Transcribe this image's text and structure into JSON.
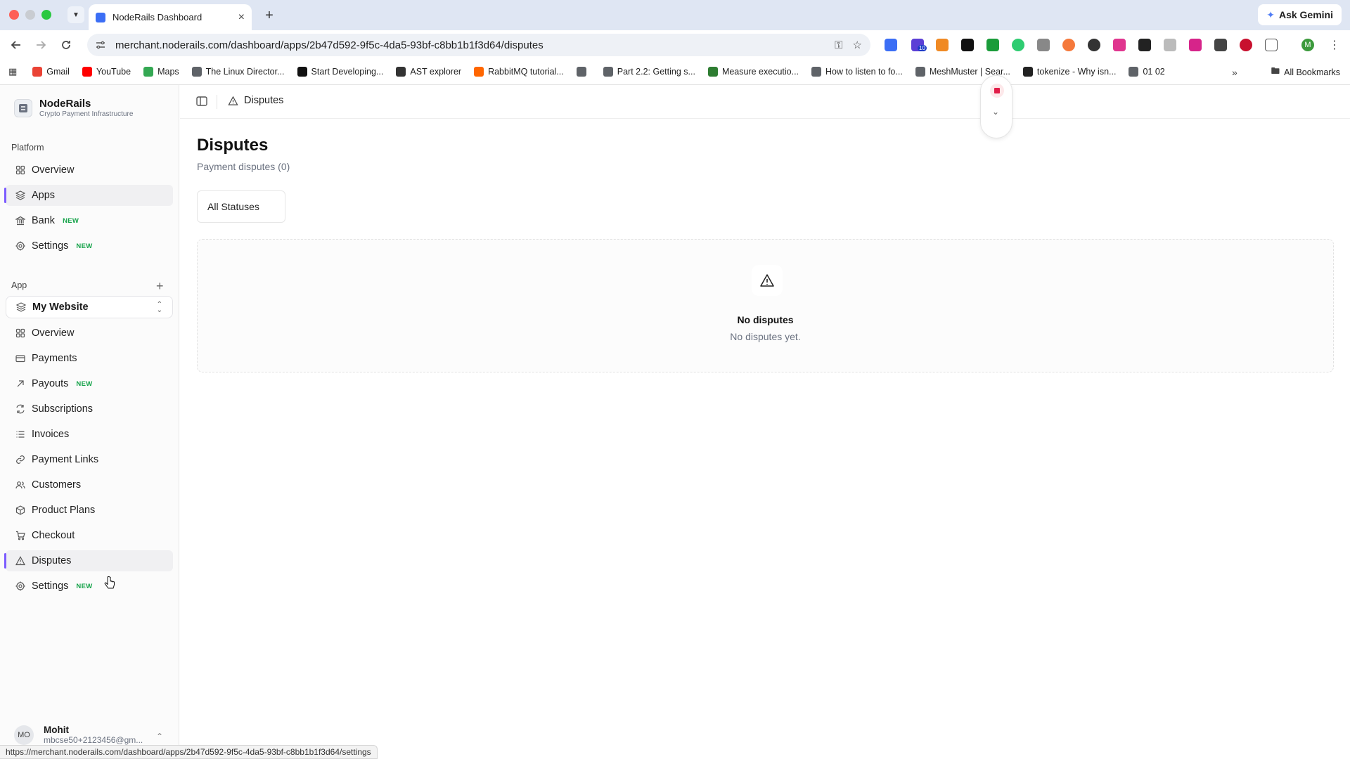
{
  "browser": {
    "tab_title": "NodeRails Dashboard",
    "url": "merchant.noderails.com/dashboard/apps/2b47d592-9f5c-4da5-93bf-c8bb1b1f3d64/disputes",
    "ask_gemini": "Ask Gemini",
    "profile_initial": "M",
    "ext_badge": "10",
    "bookmarks": [
      {
        "label": "Gmail",
        "color": "#ea4335"
      },
      {
        "label": "YouTube",
        "color": "#ff0000"
      },
      {
        "label": "Maps",
        "color": "#34a853"
      },
      {
        "label": "The Linux Director...",
        "color": "#5f6368"
      },
      {
        "label": "Start Developing...",
        "color": "#111111"
      },
      {
        "label": "AST explorer",
        "color": "#333333"
      },
      {
        "label": "RabbitMQ tutorial...",
        "color": "#ff6600"
      },
      {
        "label": "",
        "color": "#5f6368"
      },
      {
        "label": "Part 2.2: Getting s...",
        "color": "#5f6368"
      },
      {
        "label": "Measure executio...",
        "color": "#2e7d32"
      },
      {
        "label": "How to listen to fo...",
        "color": "#5f6368"
      },
      {
        "label": "MeshMuster | Sear...",
        "color": "#5f6368"
      },
      {
        "label": "tokenize - Why isn...",
        "color": "#222222"
      },
      {
        "label": "01 02",
        "color": "#5f6368"
      }
    ],
    "all_bookmarks": "All Bookmarks",
    "status_url": "https://merchant.noderails.com/dashboard/apps/2b47d592-9f5c-4da5-93bf-c8bb1b1f3d64/settings"
  },
  "brand": {
    "name": "NodeRails",
    "tagline": "Crypto Payment Infrastructure"
  },
  "sidebar": {
    "platform_label": "Platform",
    "platform_items": [
      {
        "label": "Overview",
        "icon": "grid-icon",
        "badge": ""
      },
      {
        "label": "Apps",
        "icon": "layers-icon",
        "badge": ""
      },
      {
        "label": "Bank",
        "icon": "bank-icon",
        "badge": "NEW"
      },
      {
        "label": "Settings",
        "icon": "gear-icon",
        "badge": "NEW"
      }
    ],
    "app_label": "App",
    "selected_app": "My Website",
    "app_items": [
      {
        "label": "Overview",
        "icon": "grid-icon",
        "badge": ""
      },
      {
        "label": "Payments",
        "icon": "card-icon",
        "badge": ""
      },
      {
        "label": "Payouts",
        "icon": "arrow-up-right-icon",
        "badge": "NEW"
      },
      {
        "label": "Subscriptions",
        "icon": "refresh-icon",
        "badge": ""
      },
      {
        "label": "Invoices",
        "icon": "list-icon",
        "badge": ""
      },
      {
        "label": "Payment Links",
        "icon": "link-icon",
        "badge": ""
      },
      {
        "label": "Customers",
        "icon": "users-icon",
        "badge": ""
      },
      {
        "label": "Product Plans",
        "icon": "box-icon",
        "badge": ""
      },
      {
        "label": "Checkout",
        "icon": "cart-icon",
        "badge": ""
      },
      {
        "label": "Disputes",
        "icon": "warning-icon",
        "badge": ""
      },
      {
        "label": "Settings",
        "icon": "gear-icon",
        "badge": "NEW"
      }
    ],
    "user": {
      "initials": "MO",
      "name": "Mohit",
      "email": "mbcse50+2123456@gm..."
    }
  },
  "header": {
    "breadcrumb": "Disputes"
  },
  "page": {
    "title": "Disputes",
    "subtitle": "Payment disputes (0)",
    "filter": "All Statuses",
    "empty_title": "No disputes",
    "empty_subtitle": "No disputes yet."
  },
  "colors": {
    "accent": "#7c5cff",
    "new_badge": "#16a34a",
    "record": "#e11d48"
  }
}
